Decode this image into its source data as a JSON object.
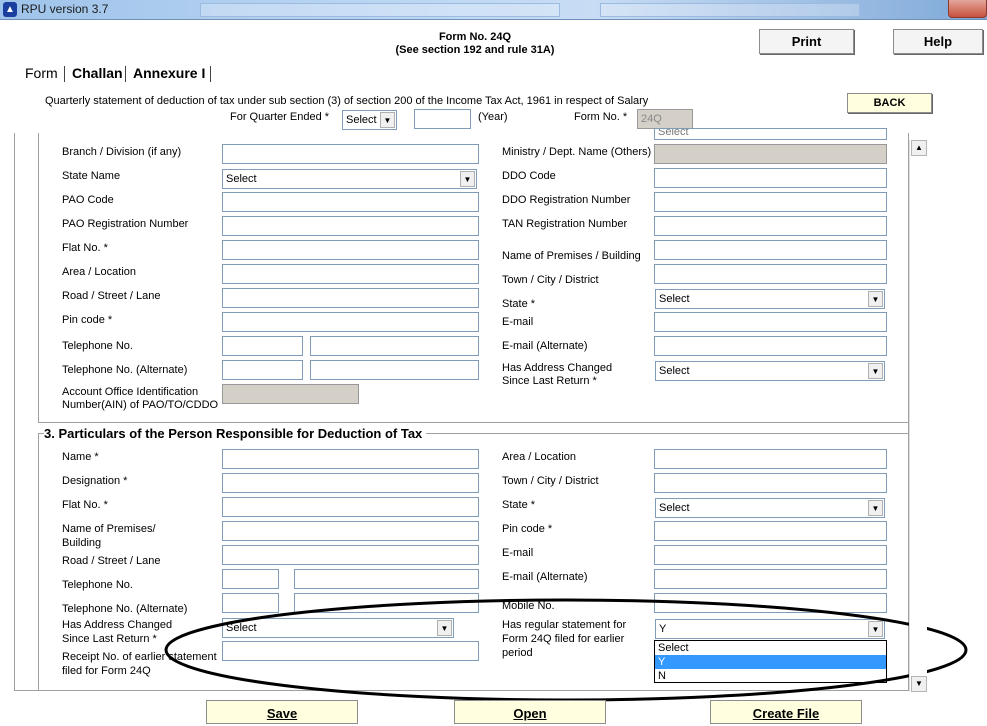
{
  "window": {
    "title": "RPU version 3.7"
  },
  "header": {
    "form_no": "Form No. 24Q",
    "section_ref": "(See section 192 and rule 31A)",
    "print_label": "Print",
    "help_label": "Help",
    "back_label": "BACK"
  },
  "tabs": [
    {
      "label": "Form",
      "active": true
    },
    {
      "label": "Challan",
      "active": false
    },
    {
      "label": "Annexure I",
      "active": false
    }
  ],
  "statement": {
    "description": "Quarterly statement of deduction of tax under sub section (3) of section 200 of the Income Tax Act, 1961 in respect of Salary",
    "quarter_label": "For Quarter Ended  *",
    "quarter_value": "Select",
    "year_label": "(Year)",
    "form_no_label": "Form No.  *",
    "form_no_value": "24Q"
  },
  "deductor": {
    "partial_select_value": "Select",
    "branch": "Branch / Division (if any)",
    "ministry": "Ministry / Dept. Name (Others)",
    "state_name": "State Name",
    "state_name_value": "Select",
    "ddo_code": "DDO Code",
    "pao_code": "PAO Code",
    "ddo_reg": "DDO Registration Number",
    "pao_reg": "PAO Registration Number",
    "tan_reg": "TAN Registration Number",
    "flat": "Flat No. *",
    "premises": "Name of Premises / Building",
    "area": "Area / Location",
    "town": "Town / City / District",
    "road": "Road / Street / Lane",
    "state": "State  *",
    "state_value": "Select",
    "pin": "Pin code  *",
    "email": "E-mail",
    "tel": "Telephone No.",
    "email_alt": "E-mail (Alternate)",
    "tel_alt": "Telephone No. (Alternate)",
    "addr_changed_1": "Has Address Changed",
    "addr_changed_2": "Since Last Return  *",
    "addr_changed_value": "Select",
    "ain_1": "Account Office Identification",
    "ain_2": "Number(AIN) of PAO/TO/CDDO"
  },
  "responsible": {
    "section_title": "3. Particulars of the Person Responsible for Deduction of Tax",
    "name": "Name  *",
    "area": "Area / Location",
    "designation": "Designation  *",
    "town": "Town / City / District",
    "flat": "Flat No.  *",
    "state": "State  *",
    "state_value": "Select",
    "premises_1": "Name of Premises/",
    "premises_2": "Building",
    "pin": "Pin code  *",
    "road": "Road / Street / Lane",
    "email": "E-mail",
    "tel": "Telephone No.",
    "email_alt": "E-mail (Alternate)",
    "tel_alt": "Telephone No. (Alternate)",
    "mobile": "Mobile No.",
    "addr_changed_1": "Has Address Changed",
    "addr_changed_2": "Since Last Return  *",
    "addr_changed_value": "Select",
    "regular_1": "Has regular statement for",
    "regular_2": "Form 24Q filed for earlier",
    "regular_3": "period",
    "regular_value": "Y",
    "regular_options": [
      "Select",
      "Y",
      "N"
    ],
    "receipt_1": "Receipt No. of earlier statement",
    "receipt_2": "filed for Form 24Q"
  },
  "footer": {
    "save": "Save",
    "open": "Open",
    "create": "Create File"
  }
}
